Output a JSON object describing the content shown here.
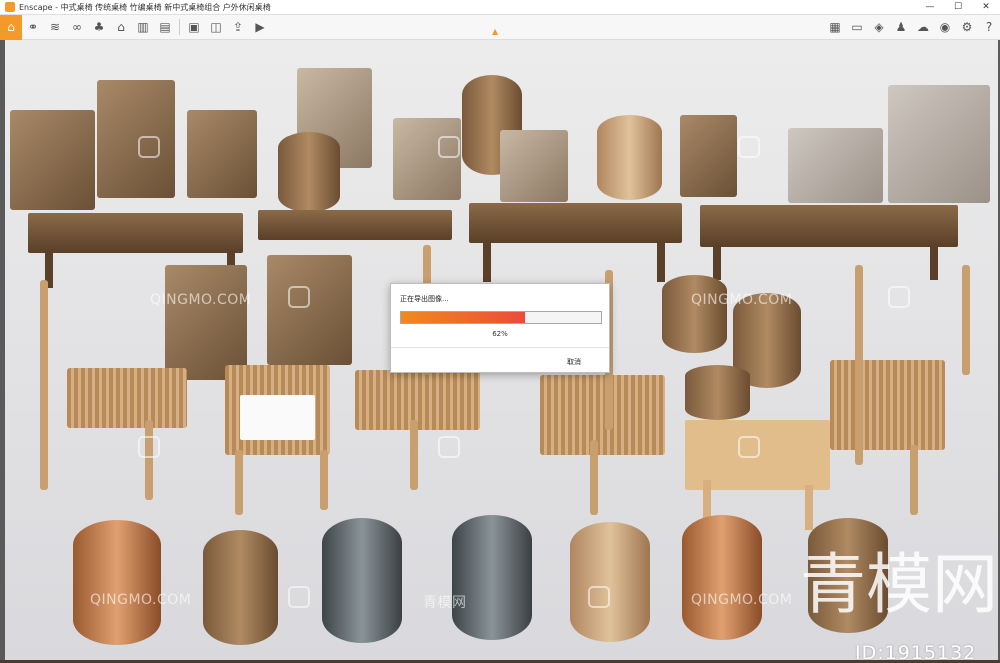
{
  "window": {
    "title": "Enscape - 中式桌椅 传统桌椅 竹编桌椅 新中式桌椅组合 户外休闲桌椅",
    "controls": {
      "minimize": "—",
      "maximize": "☐",
      "close": "✕"
    }
  },
  "toolbar": {
    "left_icons": [
      "home-icon",
      "link-icon",
      "layers-icon",
      "binoculars-icon",
      "tree-icon",
      "house-icon",
      "building-icon",
      "clapperboard-icon",
      "screenshot-icon",
      "batch-render-icon",
      "export-icon",
      "video-icon"
    ],
    "right_icons": [
      "asset-library-icon",
      "panorama-icon",
      "cube-icon",
      "people-icon",
      "cloud-icon",
      "eye-icon",
      "settings-icon",
      "help-icon"
    ],
    "accent_color": "#f39a2b"
  },
  "viewport": {
    "watermark_text": "QINGMO.COM",
    "watermark_cn": "青模网",
    "big_watermark": "青模网",
    "id_label": "ID:1915132"
  },
  "dialog": {
    "title": "正在导出图像...",
    "progress_percent": 62,
    "progress_label": "62%",
    "cancel_label": "取消",
    "progress_colors": [
      "#f08a1c",
      "#ee4a3a"
    ]
  }
}
